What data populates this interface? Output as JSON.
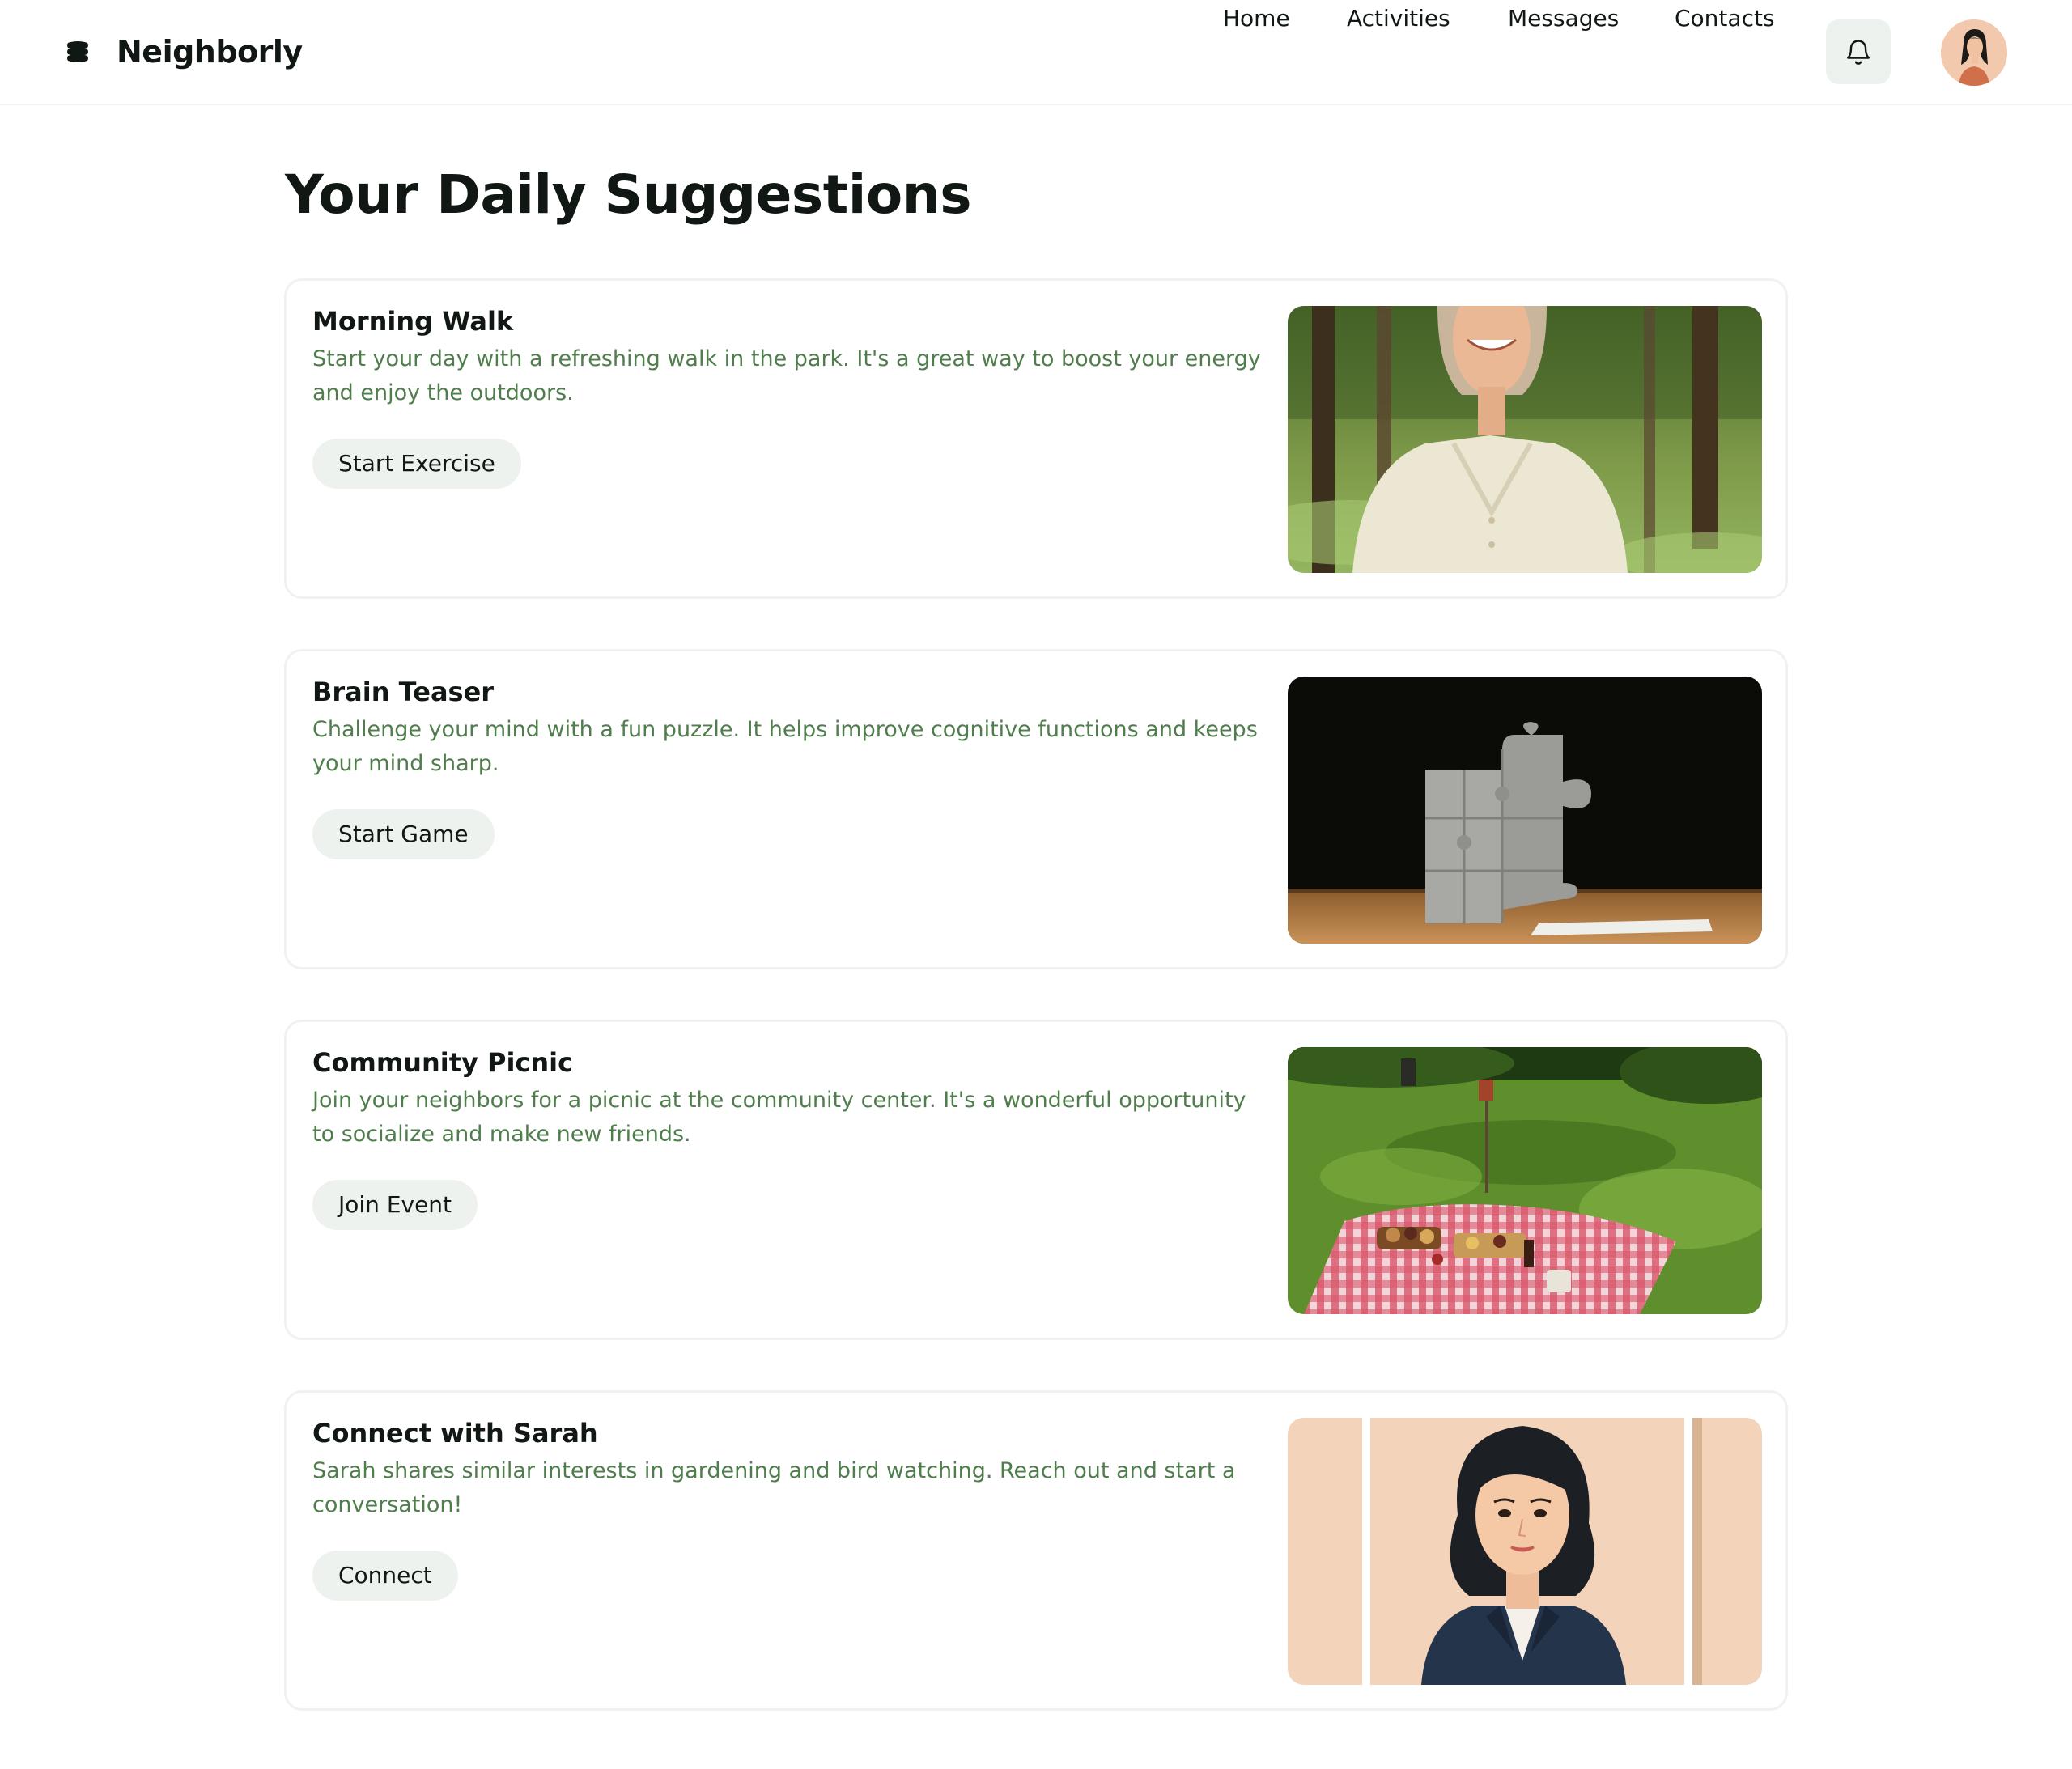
{
  "header": {
    "brand_icon": "logo-icon",
    "brand_name": "Neighborly",
    "nav": [
      {
        "label": "Home"
      },
      {
        "label": "Activities"
      },
      {
        "label": "Messages"
      },
      {
        "label": "Contacts"
      }
    ],
    "notification_icon": "bell-icon",
    "avatar_icon": "user-avatar"
  },
  "page": {
    "title": "Your Daily Suggestions"
  },
  "cards": [
    {
      "title": "Morning Walk",
      "description": "Start your day with a refreshing walk in the park. It's a great way to boost your energy and enjoy the outdoors.",
      "button": "Start Exercise",
      "image": "woman-in-park-photo"
    },
    {
      "title": "Brain Teaser",
      "description": "Challenge your mind with a fun puzzle. It helps improve cognitive functions and keeps your mind sharp.",
      "button": "Start Game",
      "image": "puzzle-pieces-photo"
    },
    {
      "title": "Community Picnic",
      "description": "Join your neighbors for a picnic at the community center. It's a wonderful opportunity to socialize and make new friends.",
      "button": "Join Event",
      "image": "picnic-blanket-photo"
    },
    {
      "title": "Connect with Sarah",
      "description": "Sarah shares similar interests in gardening and bird watching. Reach out and start a conversation!",
      "button": "Connect",
      "image": "sarah-portrait-illustration"
    }
  ],
  "colors": {
    "accent_green": "#4f7d4c",
    "button_bg": "#eef2ef",
    "text_dark": "#111814",
    "border": "#f0f2f0"
  }
}
